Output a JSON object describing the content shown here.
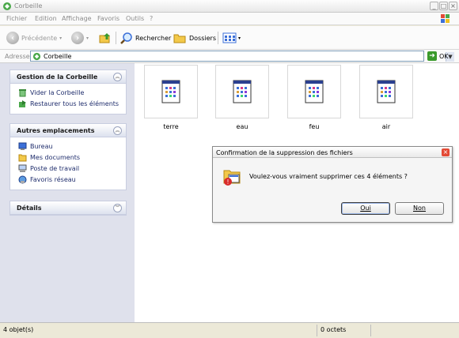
{
  "window": {
    "title": "Corbeille"
  },
  "menu": {
    "items": [
      "Fichier",
      "Edition",
      "Affichage",
      "Favoris",
      "Outils",
      "?"
    ]
  },
  "toolbar": {
    "back_label": "Précédente",
    "search_label": "Rechercher",
    "folders_label": "Dossiers"
  },
  "address": {
    "label": "Adresse",
    "value": "Corbeille",
    "go_label": "OK"
  },
  "sidebar": {
    "panels": [
      {
        "title": "Gestion de la Corbeille",
        "items": [
          "Vider la Corbeille",
          "Restaurer tous les éléments"
        ]
      },
      {
        "title": "Autres emplacements",
        "items": [
          "Bureau",
          "Mes documents",
          "Poste de travail",
          "Favoris réseau"
        ]
      },
      {
        "title": "Détails",
        "items": []
      }
    ]
  },
  "files": [
    "terre",
    "eau",
    "feu",
    "air"
  ],
  "dialog": {
    "title": "Confirmation de la suppression des fichiers",
    "message": "Voulez-vous vraiment supprimer ces 4 éléments ?",
    "yes_label": "Oui",
    "no_label": "Non"
  },
  "status": {
    "objects": "4 objet(s)",
    "size": "0 octets"
  },
  "colors": {
    "sidebar_bg": "#dfe1ec",
    "link": "#1f2d6c",
    "close_red": "#e34a35",
    "go_green": "#3a9a2b"
  }
}
